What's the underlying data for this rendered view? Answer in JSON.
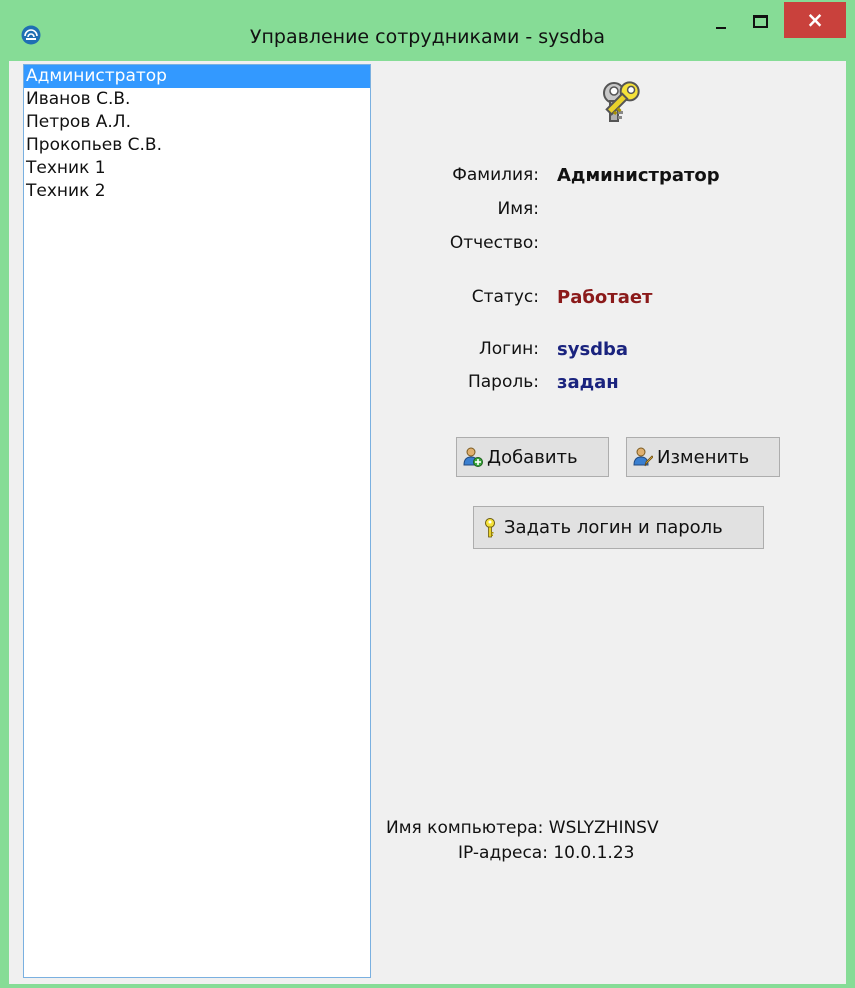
{
  "window": {
    "title": "Управление сотрудниками - sysdba",
    "close_glyph": "×"
  },
  "employees": [
    "Администратор",
    "Иванов С.В.",
    "Петров А.Л.",
    "Прокопьев С.В.",
    "Техник 1",
    "Техник 2"
  ],
  "selected_index": 0,
  "details": {
    "surname_label": "Фамилия:",
    "surname_value": "Администратор",
    "name_label": "Имя:",
    "name_value": "",
    "patronymic_label": "Отчество:",
    "patronymic_value": "",
    "status_label": "Статус:",
    "status_value": "Работает",
    "login_label": "Логин:",
    "login_value": "sysdba",
    "password_label": "Пароль:",
    "password_value": "задан"
  },
  "buttons": {
    "add": "Добавить",
    "edit": "Изменить",
    "set_login": "Задать логин и пароль"
  },
  "footer": {
    "computer_name": "Имя компьютера: WSLYZHINSV",
    "ip_addresses": "IP-адреса: 10.0.1.23"
  },
  "icons": {
    "app": "app-logo-icon",
    "keys": "keys-icon",
    "add_user": "add-user-icon",
    "edit_user": "edit-user-icon",
    "key": "key-icon"
  },
  "colors": {
    "titlebar": "#86dc96",
    "close": "#c9413c",
    "selection": "#3399ff",
    "status": "#8b1a1a",
    "login": "#1a237e"
  }
}
